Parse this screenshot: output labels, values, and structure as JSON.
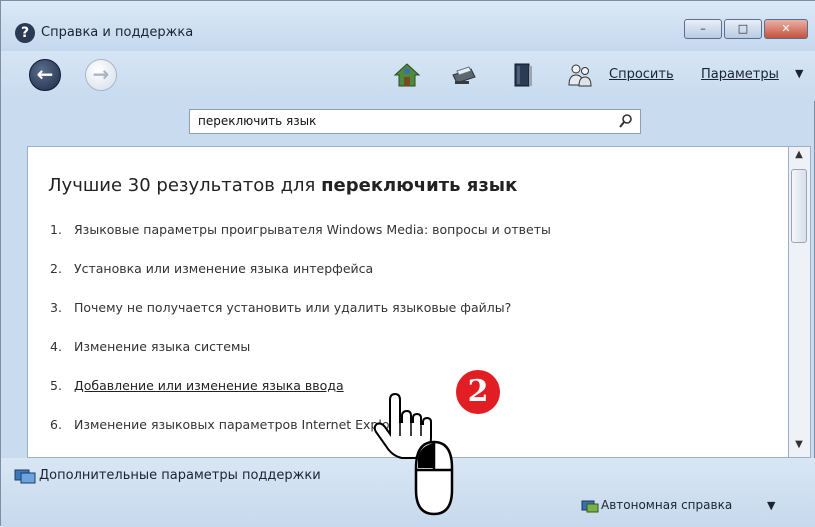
{
  "window": {
    "title": "Справка и поддержка",
    "controls": {
      "minimize": "–",
      "maximize": "□",
      "close": "✕"
    }
  },
  "toolbar": {
    "back_icon": "back-arrow-icon",
    "forward_icon": "forward-arrow-icon",
    "icons": [
      "home-icon",
      "print-icon",
      "browse-help-icon",
      "ask-people-icon"
    ],
    "ask_label": "Спросить",
    "options_label": "Параметры",
    "options_caret": "▼"
  },
  "search": {
    "value": "переключить язык",
    "icon": "search-icon"
  },
  "results": {
    "heading_prefix": "Лучшие 30 результатов для ",
    "heading_query": "переключить язык",
    "items": [
      {
        "num": "1.",
        "label": "Языковые параметры проигрывателя Windows Media: вопросы и ответы"
      },
      {
        "num": "2.",
        "label": "Установка или изменение языка интерфейса"
      },
      {
        "num": "3.",
        "label": "Почему не получается установить или удалить языковые файлы?"
      },
      {
        "num": "4.",
        "label": "Изменение языка системы"
      },
      {
        "num": "5.",
        "label": "Добавление или изменение языка ввода"
      },
      {
        "num": "6.",
        "label": "Изменение языковых параметров Internet Explorer"
      }
    ]
  },
  "footer": {
    "more_support": "Дополнительные параметры поддержки",
    "offline_help": "Автономная справка",
    "offline_caret": "▼"
  },
  "annotation": {
    "step_number": "2",
    "badge_color": "#e01e23"
  }
}
